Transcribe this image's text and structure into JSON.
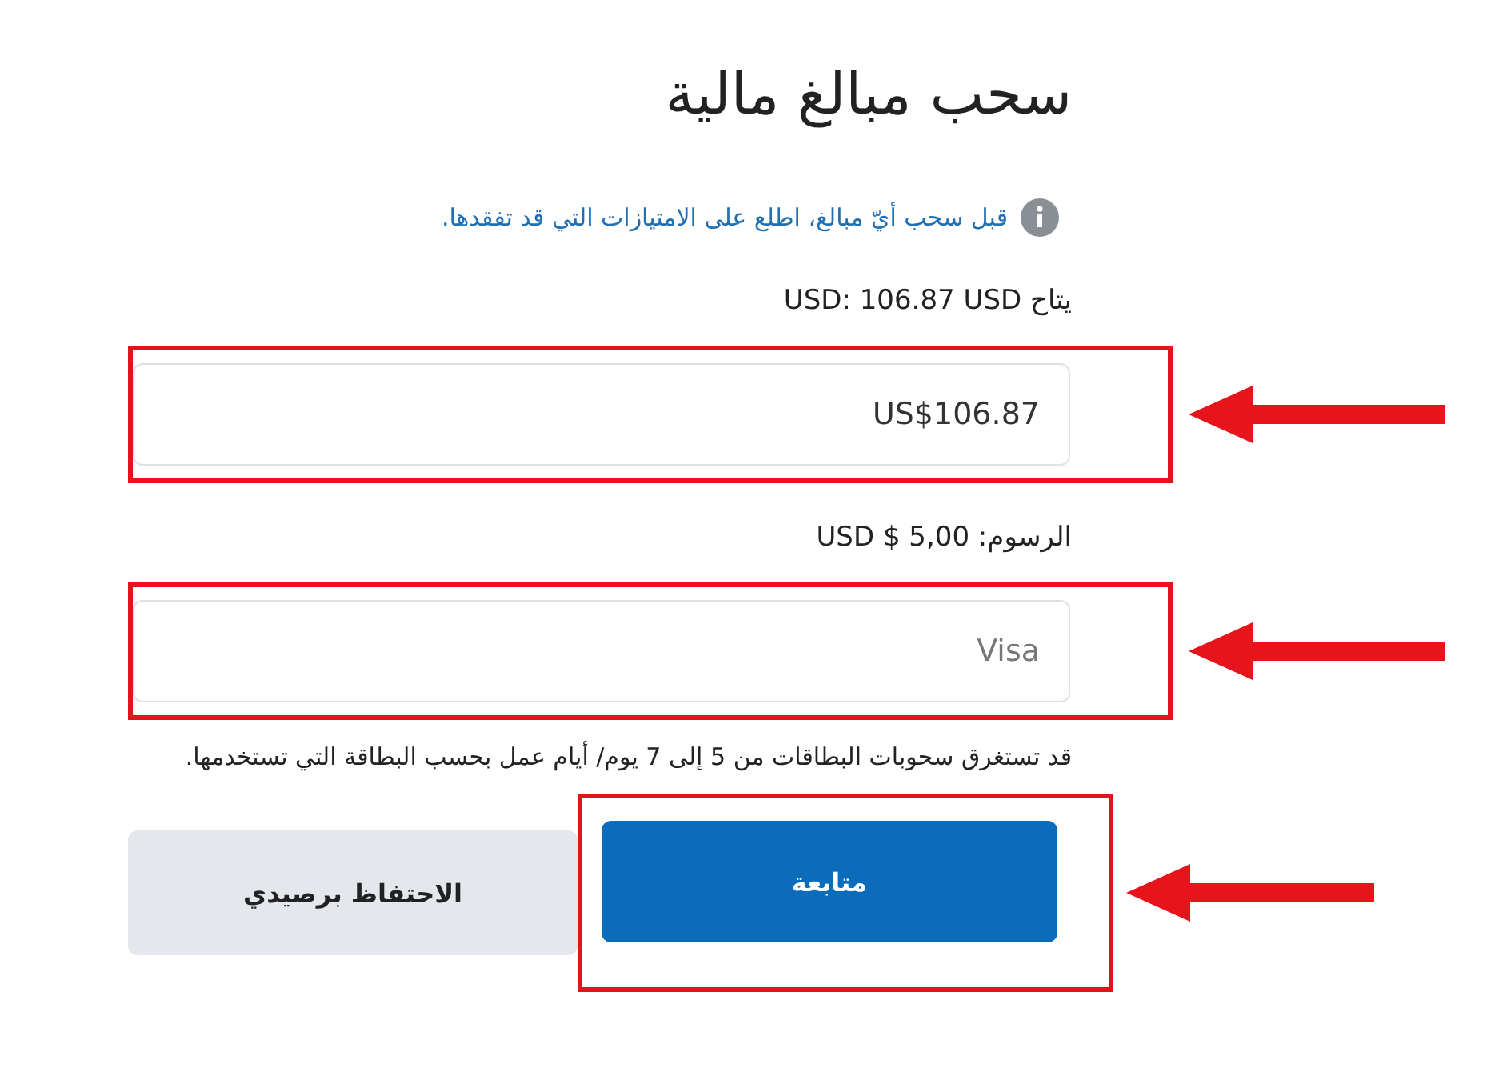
{
  "title": "سحب مبالغ مالية",
  "info": "قبل سحب أيّ مبالغ، اطلع على الامتيازات التي قد تفقدها.",
  "available": "يتاح USD: 106.87 USD",
  "amount_field": {
    "value": "US$106.87",
    "highlighted": true
  },
  "fee": "الرسوم: USD $ 5,00",
  "card_field": {
    "placeholder": "Visa",
    "highlighted": true
  },
  "note": "قد تستغرق سحوبات البطاقات من 5 إلى 7 يوم/ أيام عمل بحسب البطاقة التي تستخدمها.",
  "buttons": [
    {
      "label": "الاحتفاظ برصيدي",
      "kind": "secondary",
      "highlighted": false
    },
    {
      "label": "متابعة",
      "kind": "primary",
      "highlighted": true
    }
  ]
}
